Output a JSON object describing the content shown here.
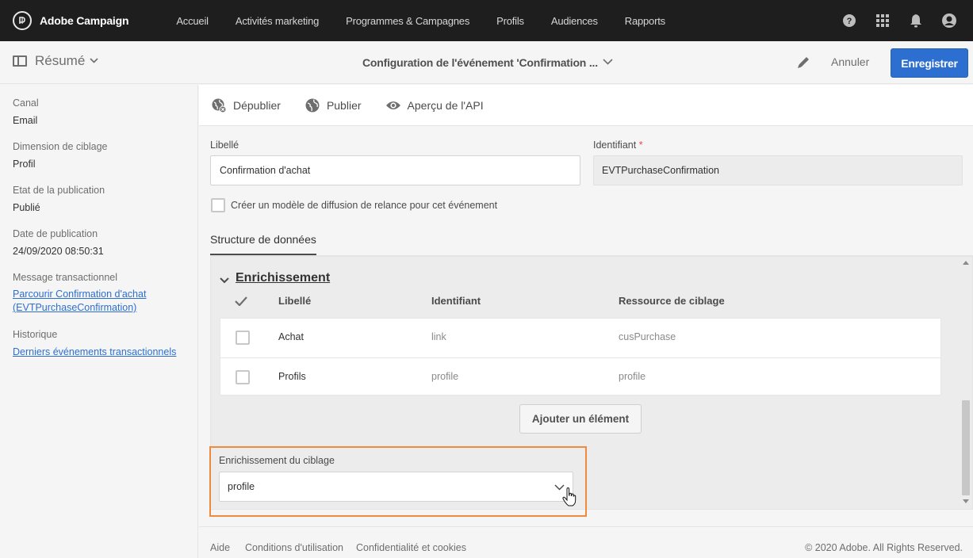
{
  "app": {
    "title": "Adobe Campaign",
    "nav": [
      "Accueil",
      "Activités marketing",
      "Programmes & Campagnes",
      "Profils",
      "Audiences",
      "Rapports"
    ]
  },
  "header": {
    "summary_label": "Résumé",
    "page_title": "Configuration de l'événement 'Confirmation ...",
    "cancel_label": "Annuler",
    "save_label": "Enregistrer"
  },
  "summary": {
    "canal_label": "Canal",
    "canal_value": "Email",
    "dimension_label": "Dimension de ciblage",
    "dimension_value": "Profil",
    "etat_label": "Etat de la publication",
    "etat_value": "Publié",
    "date_label": "Date de publication",
    "date_value": "24/09/2020 08:50:31",
    "message_label": "Message transactionnel",
    "message_link_line1": "Parcourir Confirmation d'achat",
    "message_link_line2": "(EVTPurchaseConfirmation)",
    "historique_label": "Historique",
    "historique_link": "Derniers événements transactionnels"
  },
  "actions": {
    "unpublish": "Dépublier",
    "publish": "Publier",
    "api_preview": "Aperçu de l'API"
  },
  "form": {
    "libelle_label": "Libellé",
    "libelle_value": "Confirmation d'achat",
    "identifiant_label": "Identifiant",
    "identifiant_required": "*",
    "identifiant_value": "EVTPurchaseConfirmation",
    "reminder_checkbox_label": "Créer un modèle de diffusion de relance pour cet événement",
    "tab_label": "Structure de données"
  },
  "enrichment": {
    "section_title": "Enrichissement",
    "columns": [
      "Libellé",
      "Identifiant",
      "Ressource de ciblage"
    ],
    "rows": [
      {
        "libelle": "Achat",
        "identifiant": "link",
        "ressource": "cusPurchase"
      },
      {
        "libelle": "Profils",
        "identifiant": "profile",
        "ressource": "profile"
      }
    ],
    "add_button": "Ajouter un élément",
    "targeting_label": "Enrichissement du ciblage",
    "targeting_value": "profile"
  },
  "footer": {
    "help": "Aide",
    "terms": "Conditions d'utilisation",
    "privacy": "Confidentialité et cookies",
    "copyright": "© 2020 Adobe. All Rights Reserved."
  },
  "colors": {
    "primary": "#2d6fd1",
    "highlight": "#f08a3e",
    "topbar": "#1e1e1e"
  }
}
